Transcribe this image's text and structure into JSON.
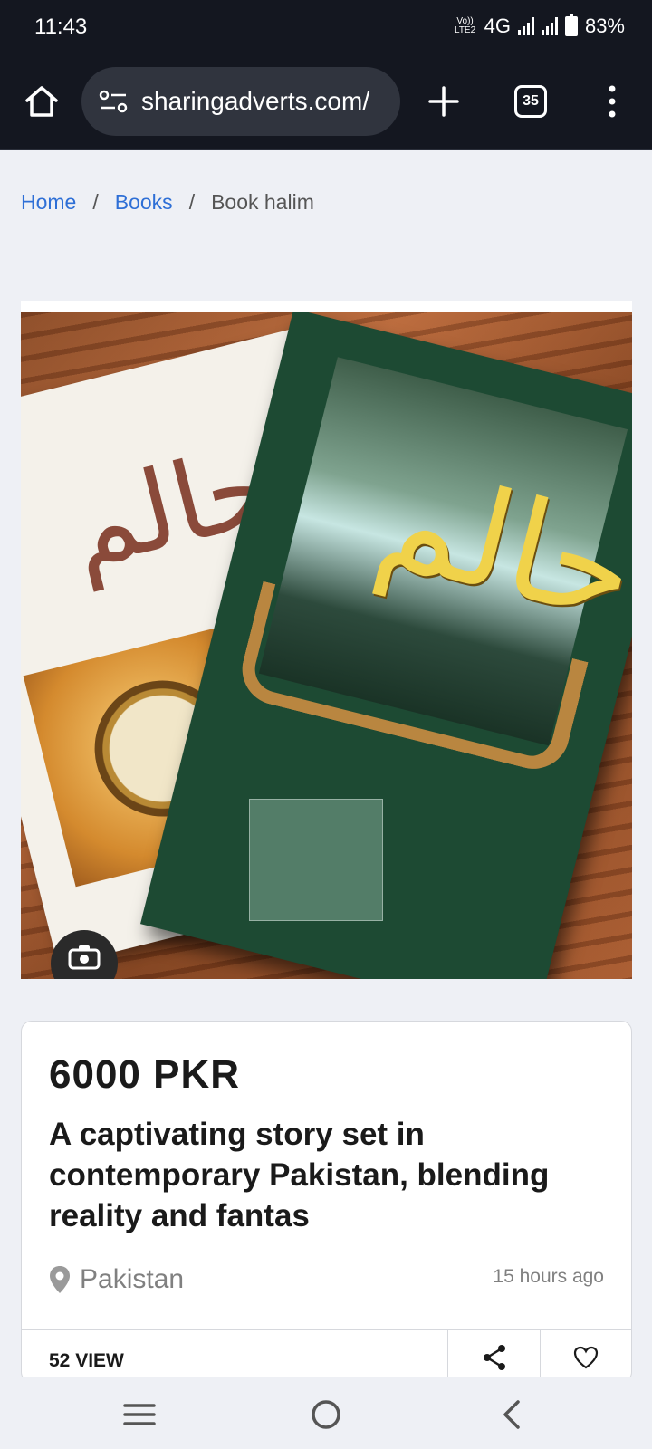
{
  "status": {
    "time": "11:43",
    "volte": "Vo)) LTE2",
    "network": "4G",
    "battery": "83%"
  },
  "browser": {
    "url": "sharingadverts.com/",
    "tab_count": "35"
  },
  "breadcrumb": {
    "home": "Home",
    "separator": "/",
    "category": "Books",
    "current": "Book halim"
  },
  "listing": {
    "price": "6000 PKR",
    "title": "A captivating story set in contemporary Pakistan, blending reality and fantas",
    "location": "Pakistan",
    "posted": "15 hours ago",
    "views": "52 VIEW"
  },
  "image": {
    "cover_text": "حالم"
  },
  "colors": {
    "link": "#2e6fd6",
    "top_bar": "#141720",
    "muted_text": "#808080"
  },
  "icons": [
    "home-icon",
    "site-settings-icon",
    "plus-icon",
    "tab-switcher-icon",
    "more-vert-icon",
    "camera-icon",
    "location-pin-icon",
    "share-icon",
    "heart-icon",
    "recents-icon",
    "home-nav-icon",
    "back-icon"
  ]
}
